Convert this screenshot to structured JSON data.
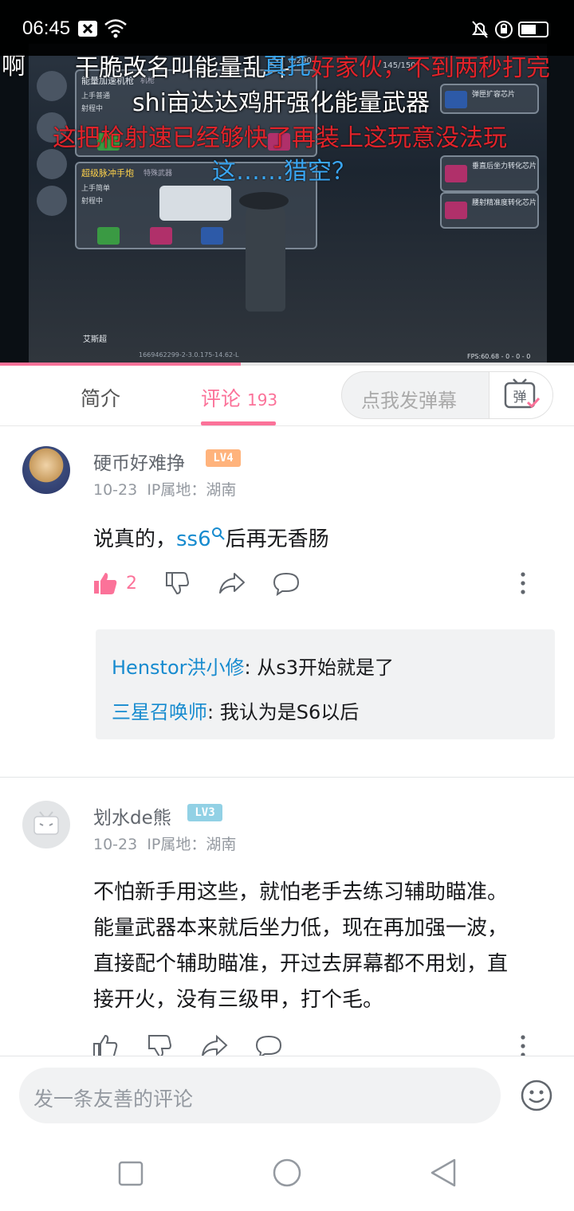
{
  "status_bar": {
    "time": "06:45"
  },
  "video": {
    "danmaku": [
      {
        "text": "啊",
        "color": "white"
      },
      {
        "text": "干脆改名叫能量乱斗",
        "color": "white"
      },
      {
        "text": "真托",
        "color": "blue"
      },
      {
        "text": "好家伙，不到两秒打完",
        "color": "red"
      },
      {
        "text": "shi亩达达鸡肝强化能量武器",
        "color": "white"
      },
      {
        "text": "这把枪射速已经够快了再装上这玩意没法玩",
        "color": "red"
      },
      {
        "text": "这……猎空？",
        "color": "blue"
      }
    ],
    "progress_fraction": 0.42,
    "game_ui": {
      "weapon1": "能量加速机枪",
      "weapon1_type": "机枪",
      "weapon2": "超级脉冲手炮",
      "weapon2_type": "特殊武器",
      "tag_a": "上手普通",
      "tag_b": "射程中",
      "tag_c": "上手简单",
      "ammo": "145/150",
      "ammo2": "6/290",
      "chip1": "弹匣扩容芯片",
      "chip2": "垂直后坐力转化芯片",
      "chip3": "腰射精准度转化芯片",
      "player": "艾斯超",
      "fps": "FPS:60.68 - 0 - 0 - 0",
      "code": "1669462299-2-3.0.175-14.62-L"
    }
  },
  "tabs": {
    "intro": "简介",
    "comments": "评论",
    "comment_count": "193",
    "danmaku_placeholder": "点我发弹幕",
    "danmaku_button": "弹"
  },
  "comments": [
    {
      "username": "硬币好难挣",
      "level": "LV4",
      "level_color": "#ffb37c",
      "date": "10-23",
      "location": "IP属地：湖南",
      "content_before": "说真的，",
      "content_link": "ss6",
      "content_after": "后再无香肠",
      "likes": "2",
      "replies": [
        {
          "name": "Henstor洪小修",
          "text": ": 从s3开始就是了"
        },
        {
          "name": "三星召唤师",
          "text": ": 我认为是S6以后"
        }
      ]
    },
    {
      "username": "划水de熊",
      "level": "LV3",
      "level_color": "#92d1e5",
      "date": "10-23",
      "location": "IP属地：湖南",
      "lines": [
        "不怕新手用这些，就怕老手去练习辅助瞄准。",
        "能量武器本来就后坐力低，现在再加强一波，",
        "直接配个辅助瞄准，开过去屏幕都不用划，直",
        "接开火，没有三级甲，打个毛。"
      ]
    }
  ],
  "bottom_bar": {
    "placeholder": "发一条友善的评论"
  }
}
